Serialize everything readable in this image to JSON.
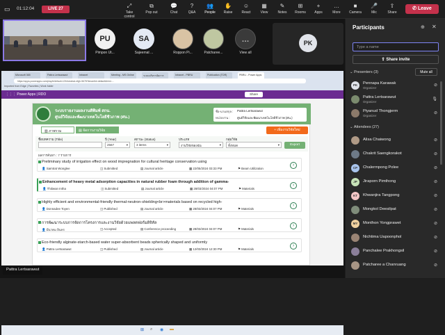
{
  "meeting": {
    "timer": "01:12:04",
    "live_label": "LIVE",
    "live_count": "27",
    "leave_label": "Leave"
  },
  "toolbar": [
    {
      "label": "Take control",
      "icon": "take-control-icon",
      "glyph": "⤢"
    },
    {
      "label": "Pop out",
      "icon": "pop-out-icon",
      "glyph": "⧉"
    },
    {
      "label": "Chat",
      "icon": "chat-icon",
      "glyph": "💬"
    },
    {
      "label": "Q&A",
      "icon": "qa-icon",
      "glyph": "?"
    },
    {
      "label": "People",
      "icon": "people-icon",
      "glyph": "👥"
    },
    {
      "label": "Raise",
      "icon": "raise-hand-icon",
      "glyph": "✋"
    },
    {
      "label": "React",
      "icon": "react-icon",
      "glyph": "☺"
    },
    {
      "label": "View",
      "icon": "view-icon",
      "glyph": "▦"
    },
    {
      "label": "Notes",
      "icon": "notes-icon",
      "glyph": "✎"
    },
    {
      "label": "Rooms",
      "icon": "rooms-icon",
      "glyph": "⊞"
    },
    {
      "label": "Apps",
      "icon": "apps-icon",
      "glyph": "+"
    },
    {
      "label": "More",
      "icon": "more-icon",
      "glyph": "…"
    },
    {
      "label": "Camera",
      "icon": "camera-icon",
      "glyph": "■"
    },
    {
      "label": "Mic",
      "icon": "mic-icon",
      "glyph": "🎤"
    },
    {
      "label": "Share",
      "icon": "share-icon",
      "glyph": "⇧"
    }
  ],
  "tiles": [
    {
      "initials": "PU",
      "name": "Pimpon Ut...",
      "color": "#f1f1f1"
    },
    {
      "initials": "SA",
      "name": "Sajeemat ...",
      "color": "#e4eaf4"
    },
    {
      "initials": "",
      "name": "Roppon Pi...",
      "color": "#d9c3a4"
    },
    {
      "initials": "",
      "name": "Patcharee...",
      "color": "#bfc7a1"
    },
    {
      "initials": "",
      "name": "View all",
      "color": "#3a3a3a"
    }
  ],
  "right_tile": {
    "initials": "PK"
  },
  "presenter_label": "Pattra Lertsarawut",
  "browser": {
    "tabs": [
      "Microsoft 365",
      "Pattra Lertsarawut",
      "Intranet",
      "Meeting - MS Online",
      "ระบบบริหารจัดการ",
      "Intranet - PBRU",
      "Publication (TDR)",
      "PBRU - Power Apps"
    ],
    "address": "https://apps.powerapps.com/play/e/default-1234/a/abcd-efgh-5678?tenantId=default&hint=...",
    "bookmarks": "Imported from Edge   |   Favorites   |   Work folder",
    "powerapps_label": "Power Apps  |  RDO",
    "share_btn": "Share"
  },
  "app": {
    "org_line1": "ระบบรายงานผลงานตีพิมพ์ สกน.",
    "org_line2": "ศูนย์วิจัยและพัฒนาเทคโนโลยีชีวภาพ (ศน.)",
    "user_label": "ชื่อ-นามสกุล :",
    "user_name": "Pattra Lertsarawut",
    "unit_label": "หน่วยงาน :",
    "unit_name": "ศูนย์วิจัยและพัฒนาเทคโนโลยีชีวภาพ (ศน.)",
    "tab_overview": "ภาพรวม",
    "tab_manage": "จัดการงานวิจัย",
    "add_btn": "+ เพิ่มงานวิจัยใหม่",
    "filters": {
      "title_label": "ชื่อบทความ (Title)",
      "title_value": "",
      "year_label": "ปี (Year)",
      "year_value": "2567",
      "status_label": "สถานะ (Status)",
      "status_value": "3 items",
      "type_label": "ประเภท",
      "type_value": "งานวิจัยของฉัน",
      "group_label": "กลุ่มวิจัย",
      "group_value": "ทั้งหมด",
      "export_btn": "Export"
    },
    "results_count": "ผลการค้นหา : 7 รายการ",
    "rows": [
      {
        "title": "Preliminary study of irrigation effect on wood impregnation for cultural heritage conservation using",
        "author": "Samtrat Wonglee",
        "status": "Submitted",
        "type": "Journal article",
        "date": "22/05/2024 03:33 PM",
        "category": "Beam Utilization"
      },
      {
        "title": "Enhancement of heavy metal adsorption capacities in natural rubber foam through addition of gamma-",
        "author": "Thitiwan Intha",
        "status": "Submitted",
        "type": "Journal article",
        "date": "28/03/2024 04:07 PM",
        "category": "Materials"
      },
      {
        "title": "Highly efficient and environmental-friendly thermal-neutron-shielding<br>materials based on recycled high-",
        "author": "Donnadee Toyen",
        "status": "Published",
        "type": "Journal article",
        "date": "28/03/2024 04:07 PM",
        "category": "Materials"
      },
      {
        "title": "การพัฒนาระบบการจัดการโครงการและงานวิจัยด้วยแพลตฟอร์มดิจิทัล",
        "author": "มีนาคม อินทร",
        "status": "Accepted",
        "type": "Conference proceeding",
        "date": "28/03/2024 04:07 PM",
        "category": "Materials"
      },
      {
        "title": "Eco-friendly alginate-starch-based water super-absorbent beads spherically shaped and uniformly",
        "author": "Pattra Lertsarawut",
        "status": "Published",
        "type": "Journal article",
        "date": "12/03/2024 12:30 PM",
        "category": "Materials"
      }
    ]
  },
  "participants": {
    "title": "Participants",
    "search_placeholder": "Type a name",
    "share_invite": "Share invite",
    "presenters_header": "Presenters (3)",
    "mute_all": "Mute all",
    "presenters": [
      {
        "initials": "PK",
        "name": "Pennapa Karawak",
        "role": "Organizer",
        "color": "#dfe3ea"
      },
      {
        "initials": "",
        "name": "Pattra Lertsarawut",
        "role": "Organizer",
        "color": "#7b8b6e"
      },
      {
        "initials": "",
        "name": "Piyanud Thongjerm",
        "role": "Organizer",
        "color": "#8c7a6a"
      }
    ],
    "attendees_header": "Attendees (27)",
    "attendees": [
      {
        "initials": "",
        "name": "Alisa Chaiwong",
        "color": "#b09a86"
      },
      {
        "initials": "",
        "name": "Chakrit Saengkorakot",
        "color": "#6e7a87"
      },
      {
        "initials": "CP",
        "name": "Chalermpong Polee",
        "color": "#a9c5ee"
      },
      {
        "initials": "JP",
        "name": "Jiraporn Pimthong",
        "color": "#c7e3b8"
      },
      {
        "initials": "KT",
        "name": "Khwanjira Tangpong",
        "color": "#f3c6c6"
      },
      {
        "initials": "",
        "name": "Mongkol Deesilpat",
        "color": "#7f8c7a"
      },
      {
        "initials": "MY",
        "name": "Monthon Yongprawet",
        "color": "#f1d2a0"
      },
      {
        "initials": "",
        "name": "Nichtima Uapoonphol",
        "color": "#9a8474"
      },
      {
        "initials": "",
        "name": "Panchalee Prakhongsil",
        "color": "#8b7f9a"
      },
      {
        "initials": "",
        "name": "Patcharee a Chanruang",
        "color": "#a79585"
      }
    ]
  }
}
